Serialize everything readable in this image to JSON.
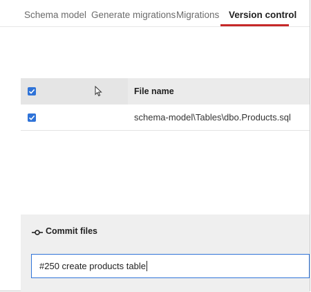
{
  "tabs": [
    {
      "label": "Schema model",
      "active": false
    },
    {
      "label": "Generate migrations",
      "active": false
    },
    {
      "label": "Migrations",
      "active": false
    },
    {
      "label": "Version control",
      "active": true
    }
  ],
  "accent_color": "#c62828",
  "checkbox_color": "#2f73d8",
  "table": {
    "header_checked": true,
    "columns": [
      "File name"
    ],
    "rows": [
      {
        "checked": true,
        "file_name": "schema-model\\Tables\\dbo.Products.sql"
      }
    ]
  },
  "commit": {
    "icon": "commit-icon",
    "title": "Commit files",
    "message": "#250 create products table"
  }
}
